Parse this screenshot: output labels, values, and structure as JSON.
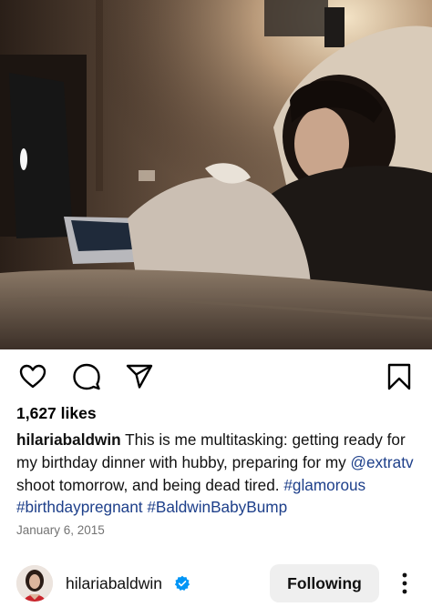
{
  "post": {
    "likes": "1,627 likes",
    "username": "hilariabaldwin",
    "caption_1": " This is me multitasking: getting ready for my birthday dinner with hubby, preparing for my ",
    "mention": "@extratv",
    "caption_2": " shoot tomorrow, and being dead tired. ",
    "hashtags": [
      "#glamorous",
      "#birthdaypregnant",
      "#BaldwinBabyBump"
    ],
    "date": "January 6, 2015"
  },
  "actions": {
    "like_icon": "heart-outline",
    "comment_icon": "speech-bubble-outline",
    "share_icon": "paper-plane",
    "save_icon": "bookmark-outline"
  },
  "footer": {
    "username": "hilariabaldwin",
    "verified": true,
    "follow_button": "Following",
    "more_icon": "vertical-ellipsis"
  },
  "colors": {
    "link": "#1d3f8a",
    "verified_badge": "#0095f6",
    "button_bg": "#efefef",
    "date_text": "#737373"
  }
}
